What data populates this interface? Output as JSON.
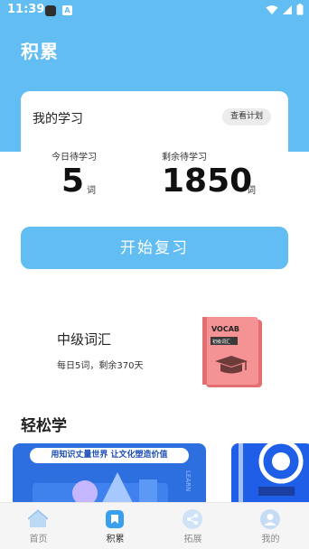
{
  "status_bar": {
    "time": "11:39",
    "app_badge": "A"
  },
  "header": {
    "title": "积累"
  },
  "study_card": {
    "title": "我的学习",
    "view_plan": "查看计划",
    "today": {
      "label": "今日待学习",
      "value": "5",
      "unit": "词"
    },
    "remaining": {
      "label": "剩余待学习",
      "value": "1850",
      "unit": "词"
    }
  },
  "start_button": {
    "label": "开始复习"
  },
  "wordbook": {
    "title": "中级词汇",
    "subtitle": "每日5词，剩余370天",
    "cover_title": "VOCAB",
    "cover_badge": "初级词汇"
  },
  "easy_learn": {
    "title": "轻松学",
    "banner1_tag": "用知识丈量世界 让文化塑造价值",
    "banner1_side_text": "LEARN"
  },
  "tabbar": {
    "items": [
      {
        "label": "首页",
        "icon": "home-icon",
        "active": false
      },
      {
        "label": "积累",
        "icon": "bookmark-icon",
        "active": true
      },
      {
        "label": "拓展",
        "icon": "share-icon",
        "active": false
      },
      {
        "label": "我的",
        "icon": "profile-icon",
        "active": false
      }
    ]
  },
  "colors": {
    "accent": "#61bdf2",
    "book_cover": "#f08a8c",
    "banner": "#2e6fe0"
  }
}
